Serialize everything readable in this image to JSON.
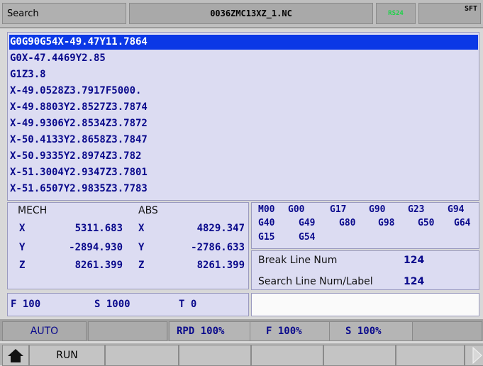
{
  "title_bar": {
    "mode": "Search",
    "filename": "0036ZMC13XZ_1.NC",
    "status": "RS24",
    "sft": "SFT"
  },
  "program": {
    "lines": [
      "G0G90G54X-49.47Y11.7864",
      "G0X-47.4469Y2.85",
      "G1Z3.8",
      "X-49.0528Z3.7917F5000.",
      "X-49.8803Y2.8527Z3.7874",
      "X-49.9306Y2.8534Z3.7872",
      "X-50.4133Y2.8658Z3.7847",
      "X-50.9335Y2.8974Z3.782",
      "X-51.3004Y2.9347Z3.7801",
      "X-51.6507Y2.9835Z3.7783"
    ],
    "selected_index": 0
  },
  "coords": {
    "mech_label": "MECH",
    "abs_label": "ABS",
    "axes": [
      "X",
      "Y",
      "Z"
    ],
    "mech": [
      "5311.683",
      "-2894.930",
      "8261.399"
    ],
    "abs": [
      "4829.347",
      "-2786.633",
      "8261.399"
    ]
  },
  "gcodes": {
    "row1": [
      "M00",
      "G00",
      "G17",
      "G90",
      "G23",
      "G94"
    ],
    "row2": [
      "G40",
      "G49",
      "G80",
      "G98",
      "G50",
      "G64"
    ],
    "row3": [
      "G15",
      "G54"
    ]
  },
  "line_info": {
    "break_label": "Break Line Num",
    "break_value": "124",
    "search_label": "Search Line Num/Label",
    "search_value": "124"
  },
  "fst": {
    "f": "F 100",
    "s": "S 1000",
    "t": "T 0"
  },
  "status_bar": {
    "mode": "AUTO",
    "rpd": "RPD 100%",
    "f_override": "F 100%",
    "s_override": "S 100%"
  },
  "softkeys": {
    "run": "RUN"
  },
  "colors": {
    "selection": "#0b38e6",
    "text_navy": "#0a0a8c",
    "status_green": "#1fd24a"
  },
  "icons": [
    "home-icon",
    "next-page-arrow-icon"
  ]
}
